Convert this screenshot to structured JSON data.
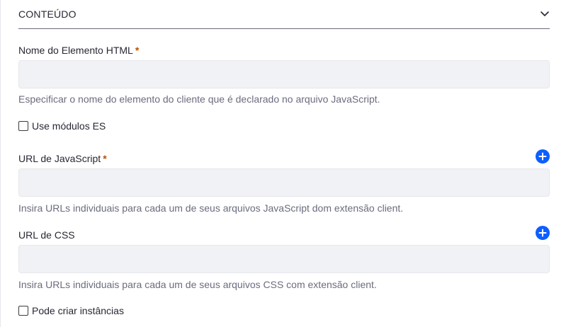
{
  "section": {
    "title": "CONTEÚDO",
    "chevron_icon": "chevron-down-icon"
  },
  "fields": {
    "element_name": {
      "label": "Nome do Elemento HTML",
      "required": "*",
      "value": "",
      "help": "Especificar o nome do elemento do cliente que é declarado no arquivo JavaScript."
    },
    "es_modules": {
      "label": "Use módulos ES",
      "checked": false
    },
    "js_url": {
      "label": "URL de JavaScript",
      "required": "*",
      "value": "",
      "add_icon": "plus-circle-icon",
      "help": "Insira URLs individuais para cada um de seus arquivos JavaScript dom extensão client."
    },
    "css_url": {
      "label": "URL de CSS",
      "value": "",
      "add_icon": "plus-circle-icon",
      "help": "Insira URLs individuais para cada um de seus arquivos CSS com extensão client."
    },
    "instanceable": {
      "label": "Pode criar instâncias",
      "checked": false
    }
  },
  "colors": {
    "accent": "#0b5fff",
    "required": "#b95000",
    "input_bg": "#f1f2f5",
    "help_text": "#6b6c7e"
  }
}
